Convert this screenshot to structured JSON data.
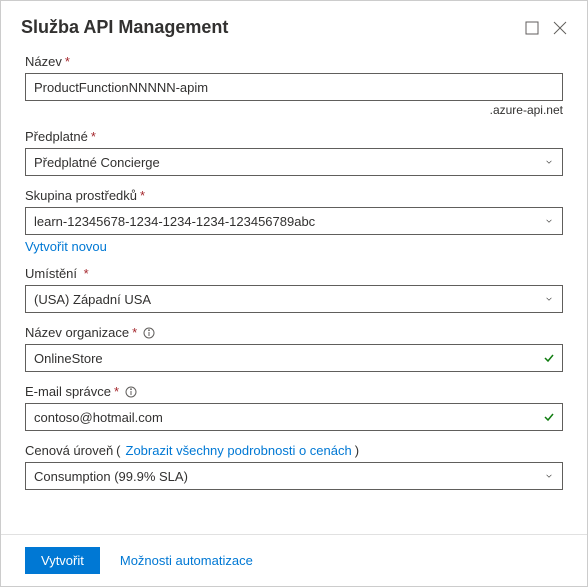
{
  "header": {
    "title": "Služba API Management"
  },
  "fields": {
    "name": {
      "label": "Název",
      "value": "ProductFunctionNNNNN-apim",
      "suffix": ".azure-api.net"
    },
    "subscription": {
      "label": "Předplatné",
      "value": "Předplatné Concierge"
    },
    "resourceGroup": {
      "label": "Skupina prostředků",
      "value": "learn-12345678-1234-1234-1234-123456789abc",
      "createNew": "Vytvořit novou"
    },
    "location": {
      "label": "Umístění",
      "value": "(USA) Západní USA"
    },
    "orgName": {
      "label": "Název organizace",
      "value": "OnlineStore"
    },
    "adminEmail": {
      "label": "E-mail správce",
      "value": "contoso@hotmail.com"
    },
    "pricingTier": {
      "label": "Cenová úroveň",
      "linkText": "Zobrazit všechny podrobnosti o cenách",
      "value": "Consumption (99.9% SLA)"
    }
  },
  "footer": {
    "create": "Vytvořit",
    "automation": "Možnosti automatizace"
  }
}
